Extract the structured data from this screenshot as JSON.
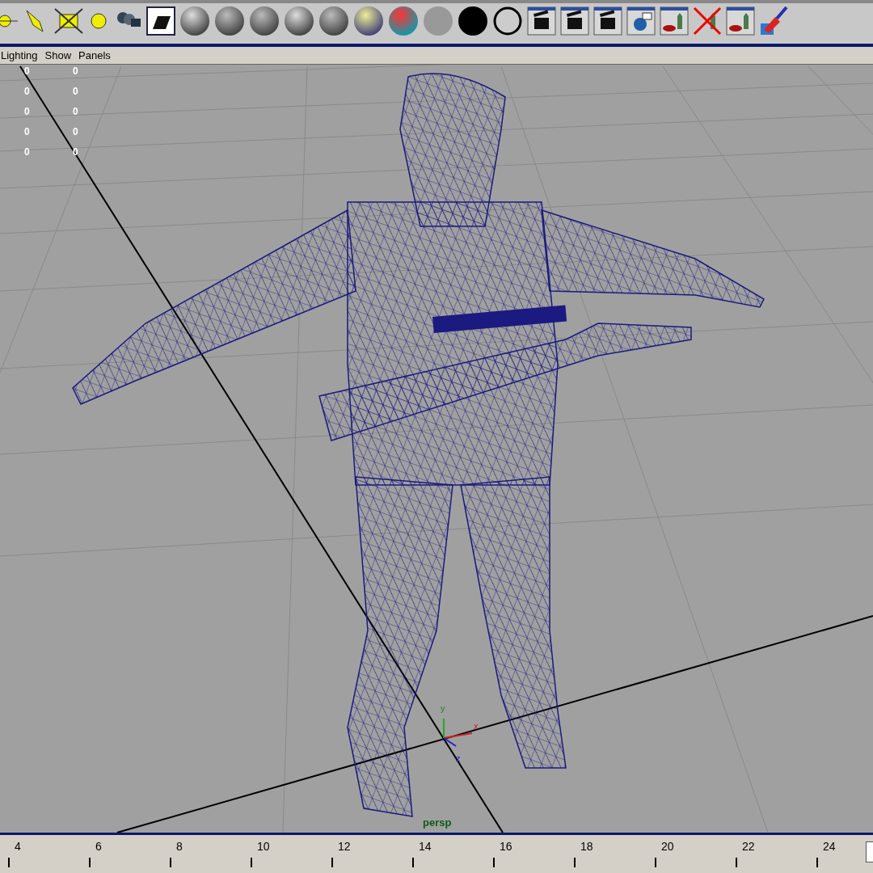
{
  "menu": [
    "Lighting",
    "Show",
    "Panels"
  ],
  "hud": [
    [
      "0",
      "0"
    ],
    [
      "0",
      "0"
    ],
    [
      "0",
      "0"
    ],
    [
      "0",
      "0"
    ],
    [
      "0",
      "0"
    ]
  ],
  "viewport": {
    "camera": "persp",
    "axes": {
      "x": "x",
      "y": "y",
      "z": "z"
    }
  },
  "timeline": {
    "ticks": [
      "4",
      "6",
      "8",
      "10",
      "12",
      "14",
      "16",
      "18",
      "20",
      "22",
      "24"
    ]
  }
}
